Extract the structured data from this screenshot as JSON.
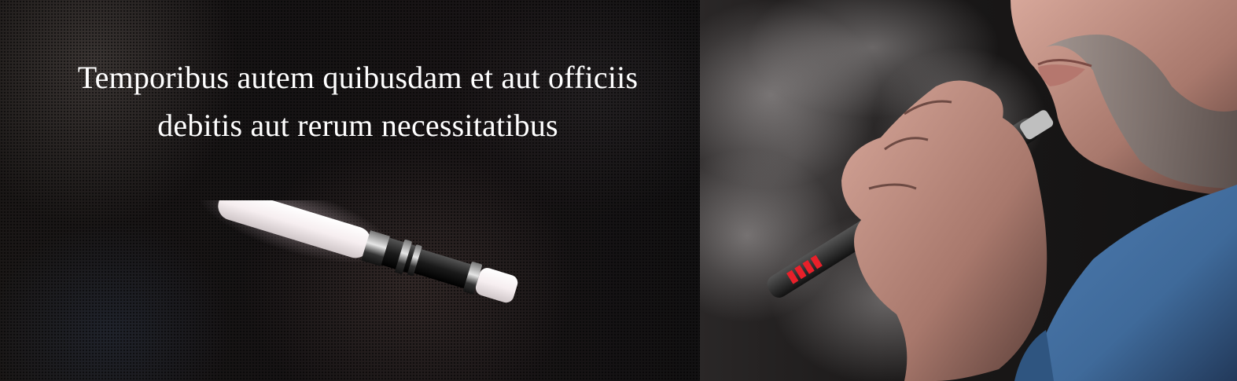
{
  "banner": {
    "headline_line1": "Temporibus autem quibusdam et aut officiis",
    "headline_line2": "debitis aut rerum necessitatibus"
  },
  "colors": {
    "headline_text": "#ffffff",
    "left_background": "#161314",
    "shirt_blue": "#3f6a9a",
    "indicator_red": "#e8202a"
  },
  "icons": {
    "product_image": "e-cigarette-icon",
    "photo": "man-vaping-photo"
  }
}
